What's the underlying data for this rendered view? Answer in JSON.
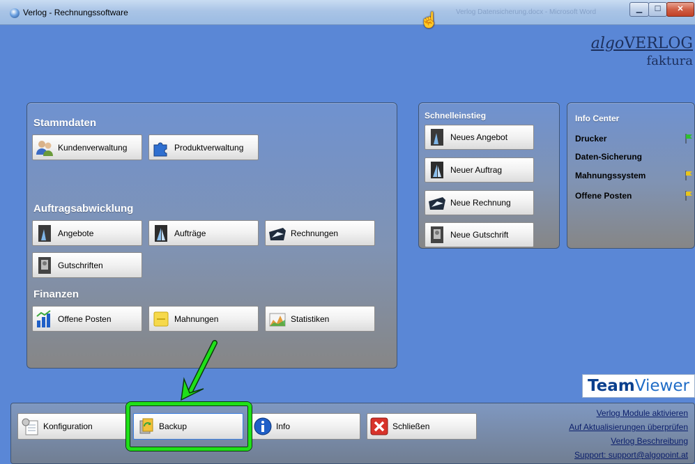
{
  "window": {
    "title": "Verlog - Rechnungssoftware",
    "background_title": "Verlog Datensicherung.docx - Microsoft Word",
    "controls": {
      "minimize": "▁",
      "maximize": "☐",
      "close": "✕"
    }
  },
  "logo": {
    "line1_italic": "algo",
    "line1_rest": "VERLOG",
    "line2": "faktura"
  },
  "stammdaten": {
    "heading": "Stammdaten",
    "buttons": [
      {
        "label": "Kundenverwaltung",
        "icon": "users-icon"
      },
      {
        "label": "Produktverwaltung",
        "icon": "puzzle-icon"
      }
    ]
  },
  "auftragsabwicklung": {
    "heading": "Auftragsabwicklung",
    "buttons": [
      {
        "label": "Angebote",
        "icon": "offer-icon"
      },
      {
        "label": "Aufträge",
        "icon": "order-icon"
      },
      {
        "label": "Rechnungen",
        "icon": "invoice-icon"
      },
      {
        "label": "Gutschriften",
        "icon": "credit-note-icon"
      }
    ]
  },
  "finanzen": {
    "heading": "Finanzen",
    "buttons": [
      {
        "label": "Offene Posten",
        "icon": "open-items-chart-icon"
      },
      {
        "label": "Mahnungen",
        "icon": "reminder-note-icon"
      },
      {
        "label": "Statistiken",
        "icon": "statistics-chart-icon"
      }
    ]
  },
  "schnelleinstieg": {
    "heading": "Schnelleinstieg",
    "buttons": [
      {
        "label": "Neues Angebot",
        "icon": "offer-icon"
      },
      {
        "label": "Neuer Auftrag",
        "icon": "order-icon"
      },
      {
        "label": "Neue Rechnung",
        "icon": "invoice-icon"
      },
      {
        "label": "Neue Gutschrift",
        "icon": "credit-note-icon"
      }
    ]
  },
  "info_center": {
    "heading": "Info Center",
    "items": [
      {
        "label": "Drucker",
        "status_color": "#2fbf2f"
      },
      {
        "label": "Daten-Sicherung",
        "status_color": ""
      },
      {
        "label": "Mahnungssystem",
        "status_color": "#e8c51b"
      },
      {
        "label": "Offene Posten",
        "status_color": "#e8c51b"
      }
    ]
  },
  "teamviewer": {
    "part1": "Team",
    "part2": "Viewer"
  },
  "bottom": {
    "buttons": [
      {
        "label": "Konfiguration",
        "icon": "configuration-icon"
      },
      {
        "label": "Backup",
        "icon": "backup-icon"
      },
      {
        "label": "Info",
        "icon": "info-icon"
      },
      {
        "label": "Schließen",
        "icon": "close-icon"
      }
    ],
    "links": [
      "Verlog Module aktivieren",
      "Auf Aktualisierungen überprüfen",
      "Verlog Beschreibung",
      "Support: support@algopoint.at"
    ]
  },
  "colors": {
    "highlight": "#1fe019",
    "arrow": "#1fe019"
  }
}
